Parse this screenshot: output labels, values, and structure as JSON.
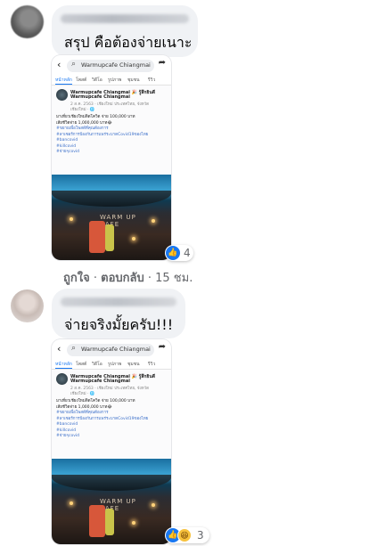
{
  "comments": [
    {
      "text": "สรุป คือต้องจ่ายเนาะ",
      "screenshot": {
        "search_text": "Warmupcafe Chiangmai",
        "tabs": [
          "หน้าหลัก",
          "โพสต์",
          "วิดีโอ",
          "รูปภาพ",
          "ชุมชน",
          "รีวิว"
        ],
        "page_name": "Warmupcafe Chiangmai 🎉 รู้สึกยินดี",
        "page_name2": "Warmupcafe Chiangmai",
        "page_meta": "2 ส.ค. 2563 · เชียงใหม่ ประเทศไทย, จังหวัด",
        "page_meta2": "เชียงใหม่ · 🌐",
        "body_lines": [
          "มาเที่ยวเชียงใหม่ติดโควิด จ่าย 100,000 บาท",
          "เสียชีวิตจ่าย 1,000,000 บาท😂"
        ],
        "tags": [
          "#ขยายเพื่อโพสต์ที่คุณต้องการ",
          "#ลาเซอร์การป้องกันการแพร่ระบาดCovid19ของไทย",
          "#bancovid",
          "#killcovid",
          "#จ่ายๆcovid"
        ],
        "sign_text": "WARM UP CAFE"
      },
      "reactions": {
        "icons": [
          "like-icon"
        ],
        "count": "4"
      },
      "actions": {
        "like": "ถูกใจ",
        "reply": "ตอบกลับ",
        "time": "15 ชม."
      }
    },
    {
      "text": "จ่ายจริงมั้ยครับ!!!",
      "screenshot": {
        "search_text": "Warmupcafe Chiangmai",
        "tabs": [
          "หน้าหลัก",
          "โพสต์",
          "วิดีโอ",
          "รูปภาพ",
          "ชุมชน",
          "รีวิว"
        ],
        "page_name": "Warmupcafe Chiangmai 🎉 รู้สึกยินดี",
        "page_name2": "Warmupcafe Chiangmai",
        "page_meta": "2 ส.ค. 2563 · เชียงใหม่ ประเทศไทย, จังหวัด",
        "page_meta2": "เชียงใหม่ · 🌐",
        "body_lines": [
          "มาเที่ยวเชียงใหม่ติดโควิด จ่าย 100,000 บาท",
          "เสียชีวิตจ่าย 1,000,000 บาท😂"
        ],
        "tags": [
          "#ขยายเพื่อโพสต์ที่คุณต้องการ",
          "#ลาเซอร์การป้องกันการแพร่ระบาดCovid19ของไทย",
          "#bancovid",
          "#killcovid",
          "#จ่ายๆcovid"
        ],
        "sign_text": "WARM UP CAFE"
      },
      "reactions": {
        "icons": [
          "like-icon",
          "haha-icon"
        ],
        "count": "3"
      }
    }
  ],
  "colors": {
    "bubble": "#f0f2f5",
    "like": "#1877f2",
    "meta": "#65676b"
  }
}
